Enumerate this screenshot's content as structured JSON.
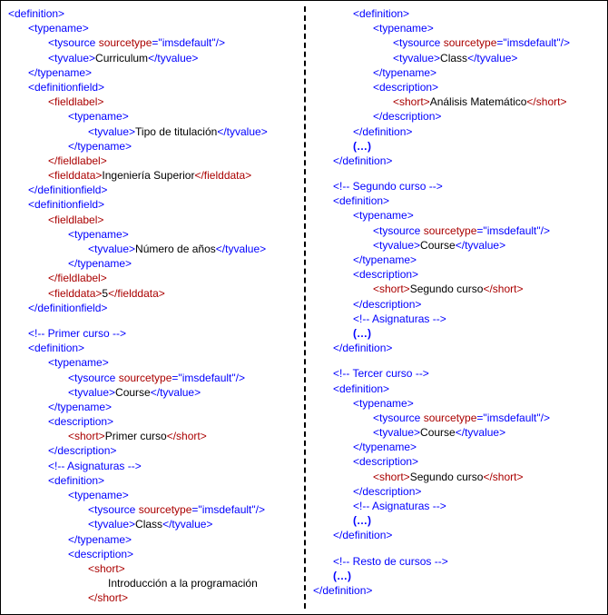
{
  "attrs": {
    "sourcetype_key": "sourcetype",
    "sourcetype_val": "imsdefault"
  },
  "left": {
    "curriculum_value": "Curriculum",
    "field1_label": "Tipo de titulación",
    "field1_data": "Ingeniería Superior",
    "field2_label": "Número de años",
    "field2_data": "5",
    "comment_primer": "Primer curso",
    "primer_course_value": "Course",
    "primer_short": "Primer curso",
    "comment_asignaturas": "Asignaturas",
    "class_value": "Class",
    "class_short_line1": "Introducción a la programación"
  },
  "right": {
    "class_value": "Class",
    "class_short": "Análisis Matemático",
    "ellipsis": "(…)",
    "comment_segundo": "Segundo curso",
    "course_value": "Course",
    "segundo_short": "Segundo curso",
    "comment_asignaturas": "Asignaturas",
    "comment_tercer": "Tercer curso",
    "tercer_short": "Segundo curso",
    "comment_resto": "Resto de cursos"
  }
}
